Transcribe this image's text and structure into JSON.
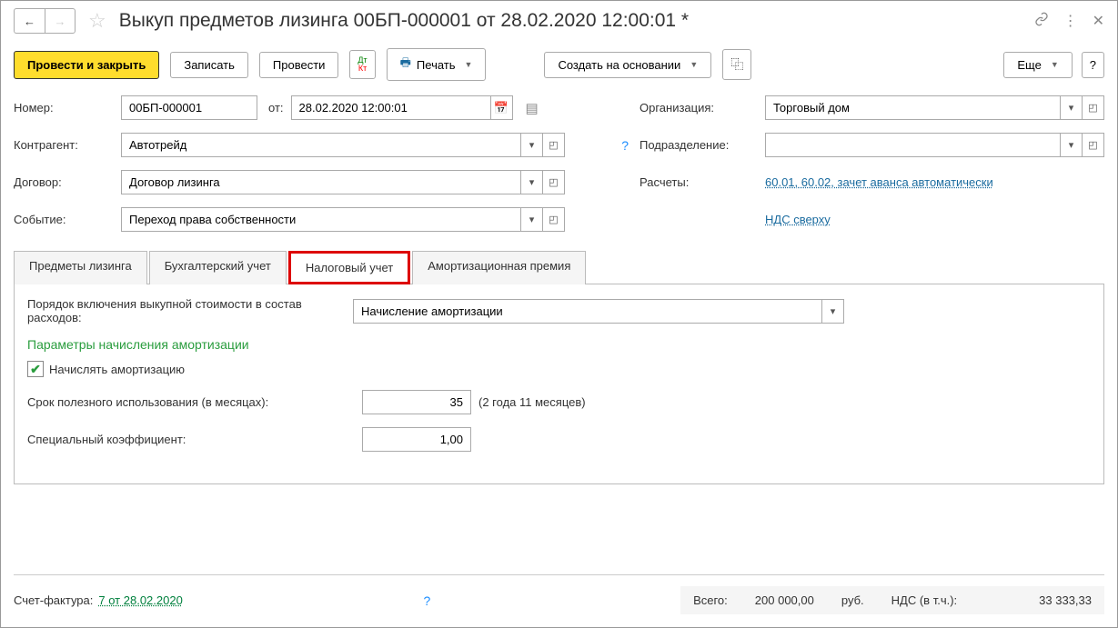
{
  "title": "Выкуп предметов лизинга 00БП-000001 от 28.02.2020 12:00:01 *",
  "toolbar": {
    "post_close": "Провести и закрыть",
    "write": "Записать",
    "post": "Провести",
    "print": "Печать",
    "create_based": "Создать на основании",
    "more": "Еще"
  },
  "fields": {
    "number_label": "Номер:",
    "number": "00БП-000001",
    "from_label": "от:",
    "date": "28.02.2020 12:00:01",
    "org_label": "Организация:",
    "org": "Торговый дом",
    "counterparty_label": "Контрагент:",
    "counterparty": "Автотрейд",
    "dept_label": "Подразделение:",
    "dept": "",
    "contract_label": "Договор:",
    "contract": "Договор лизинга",
    "calc_label": "Расчеты:",
    "calc_link": "60.01, 60.02, зачет аванса автоматически",
    "event_label": "Событие:",
    "event": "Переход права собственности",
    "vat_link": "НДС сверху"
  },
  "tabs": {
    "t1": "Предметы лизинга",
    "t2": "Бухгалтерский учет",
    "t3": "Налоговый учет",
    "t4": "Амортизационная премия"
  },
  "content": {
    "proc_label": "Порядок включения выкупной стоимости в состав расходов:",
    "proc_value": "Начисление амортизации",
    "section": "Параметры начисления амортизации",
    "amort_check": "Начислять амортизацию",
    "life_label": "Срок полезного использования (в месяцах):",
    "life_value": "35",
    "life_hint": "(2 года 11 месяцев)",
    "coef_label": "Специальный коэффициент:",
    "coef_value": "1,00"
  },
  "footer": {
    "invoice_label": "Счет-фактура:",
    "invoice_link": "7 от 28.02.2020",
    "total_label": "Всего:",
    "total": "200 000,00",
    "currency": "руб.",
    "vat_label": "НДС (в т.ч.):",
    "vat": "33 333,33"
  }
}
